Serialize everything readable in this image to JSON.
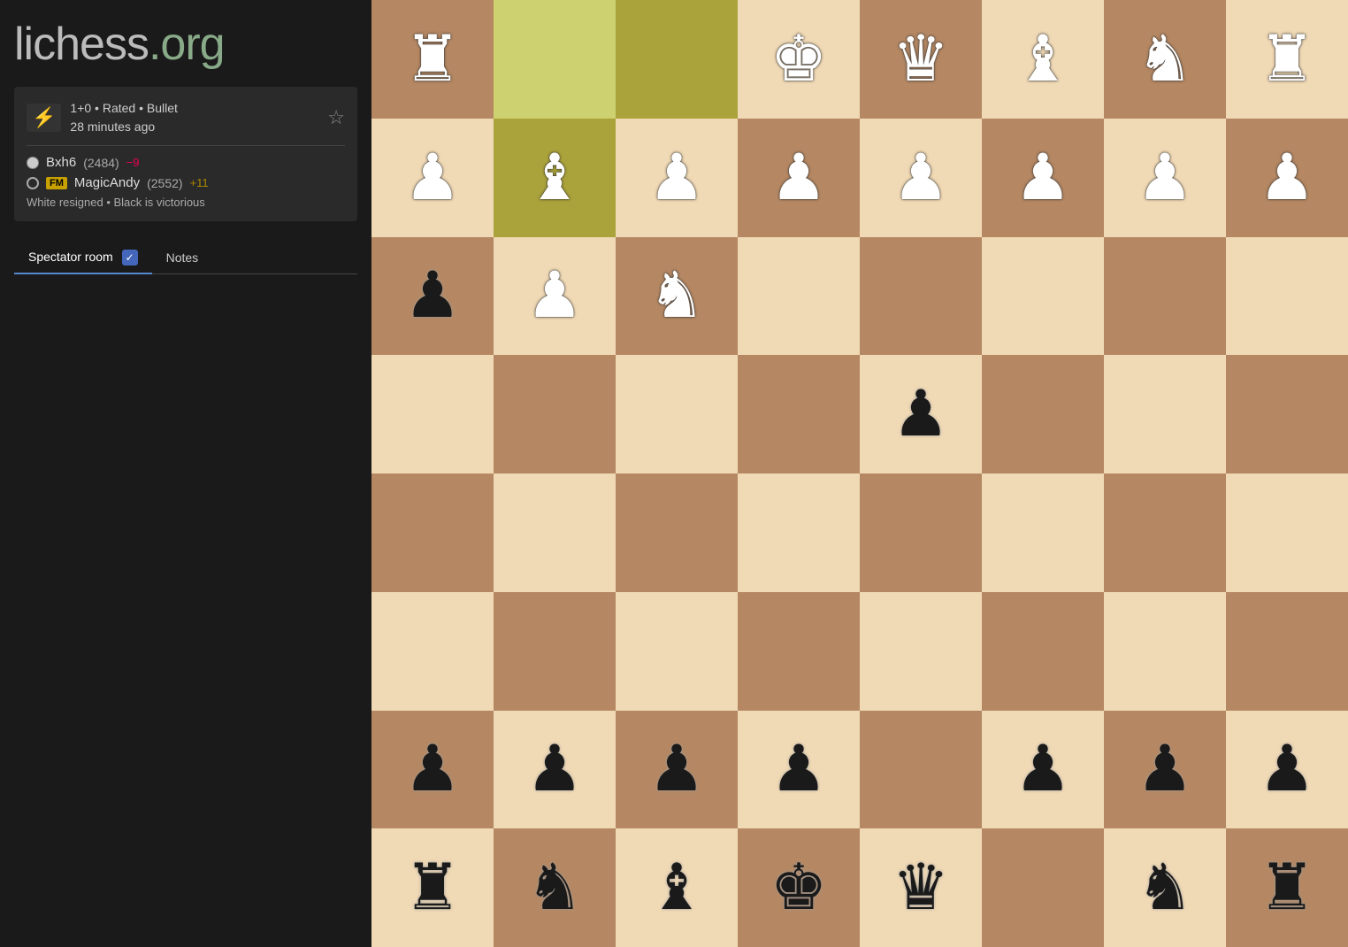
{
  "logo": {
    "prefix": "lichess",
    "suffix": ".org"
  },
  "game": {
    "rating_label": "1+0 • Rated • Bullet",
    "time_ago": "28 minutes ago",
    "favorite_label": "☆",
    "player_white": {
      "name": "Bxh6",
      "rating": "(2484)",
      "rating_change": "−9",
      "dot_type": "white"
    },
    "player_black": {
      "title": "FM",
      "name": "MagicAndy",
      "rating": "(2552)",
      "rating_change": "+11",
      "dot_type": "black"
    },
    "result": "White resigned • Black is victorious"
  },
  "tabs": {
    "spectator_label": "Spectator room",
    "notes_label": "Notes",
    "spectator_active": true
  },
  "board": {
    "colors": {
      "light": "#f0d9b5",
      "dark": "#b58863",
      "highlight_light": "#cdd16f",
      "highlight_dark": "#aaa23a"
    }
  }
}
